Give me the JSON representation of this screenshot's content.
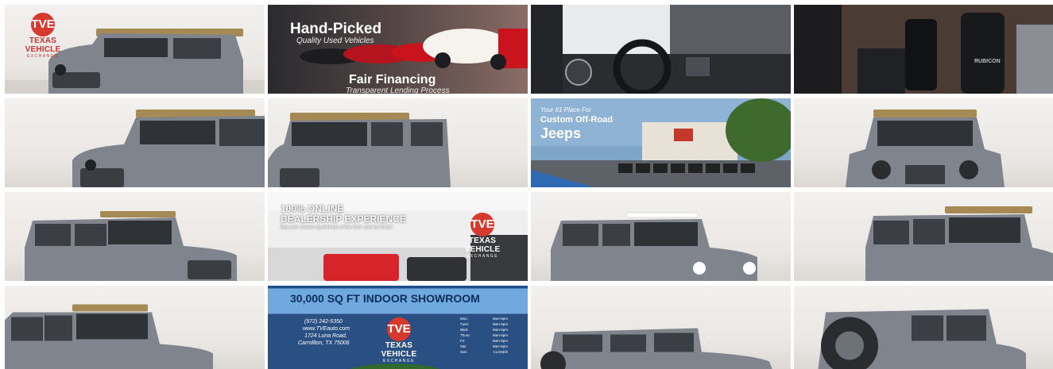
{
  "gallery": {
    "brand": {
      "logo_mark": "TVE",
      "name": "TEXAS VEHICLE",
      "sub": "EXCHANGE"
    },
    "promo_handpicked": {
      "title": "Hand-Picked",
      "subtitle": "Quality Used Vehicles",
      "title2": "Fair Financing",
      "subtitle2": "Transparent Lending Process"
    },
    "promo_jeeps": {
      "line1": "Your #1 Place For",
      "line2": "Custom Off-Road",
      "line3": "Jeeps"
    },
    "promo_online": {
      "line1": "100% ONLINE",
      "line2": "DEALERSHIP EXPERIENCE",
      "line3": "Buy your dream rig entirely online from start to finish!"
    },
    "promo_showroom": {
      "headline": "30,000 SQ FT INDOOR SHOWROOM",
      "phone": "(972) 242-5350",
      "website": "www.TVEauto.com",
      "street": "1724 Luna Road,",
      "city": "Carrollton, TX 75006",
      "hours": [
        {
          "day": "Mon:",
          "time": "9am-6pm"
        },
        {
          "day": "Tues:",
          "time": "9am-6pm"
        },
        {
          "day": "Wed:",
          "time": "9am-6pm"
        },
        {
          "day": "Thurs:",
          "time": "9am-6pm"
        },
        {
          "day": "Fri:",
          "time": "9am-6pm"
        },
        {
          "day": "Sat:",
          "time": "9am-5pm"
        },
        {
          "day": "Sun:",
          "time": "CLOSED"
        }
      ]
    },
    "dash_badge": "RUBICON",
    "colors": {
      "jeep_body": "#7f848d",
      "showroom_blue": "#1f4e8c",
      "brand_red": "#d63a2f"
    }
  }
}
